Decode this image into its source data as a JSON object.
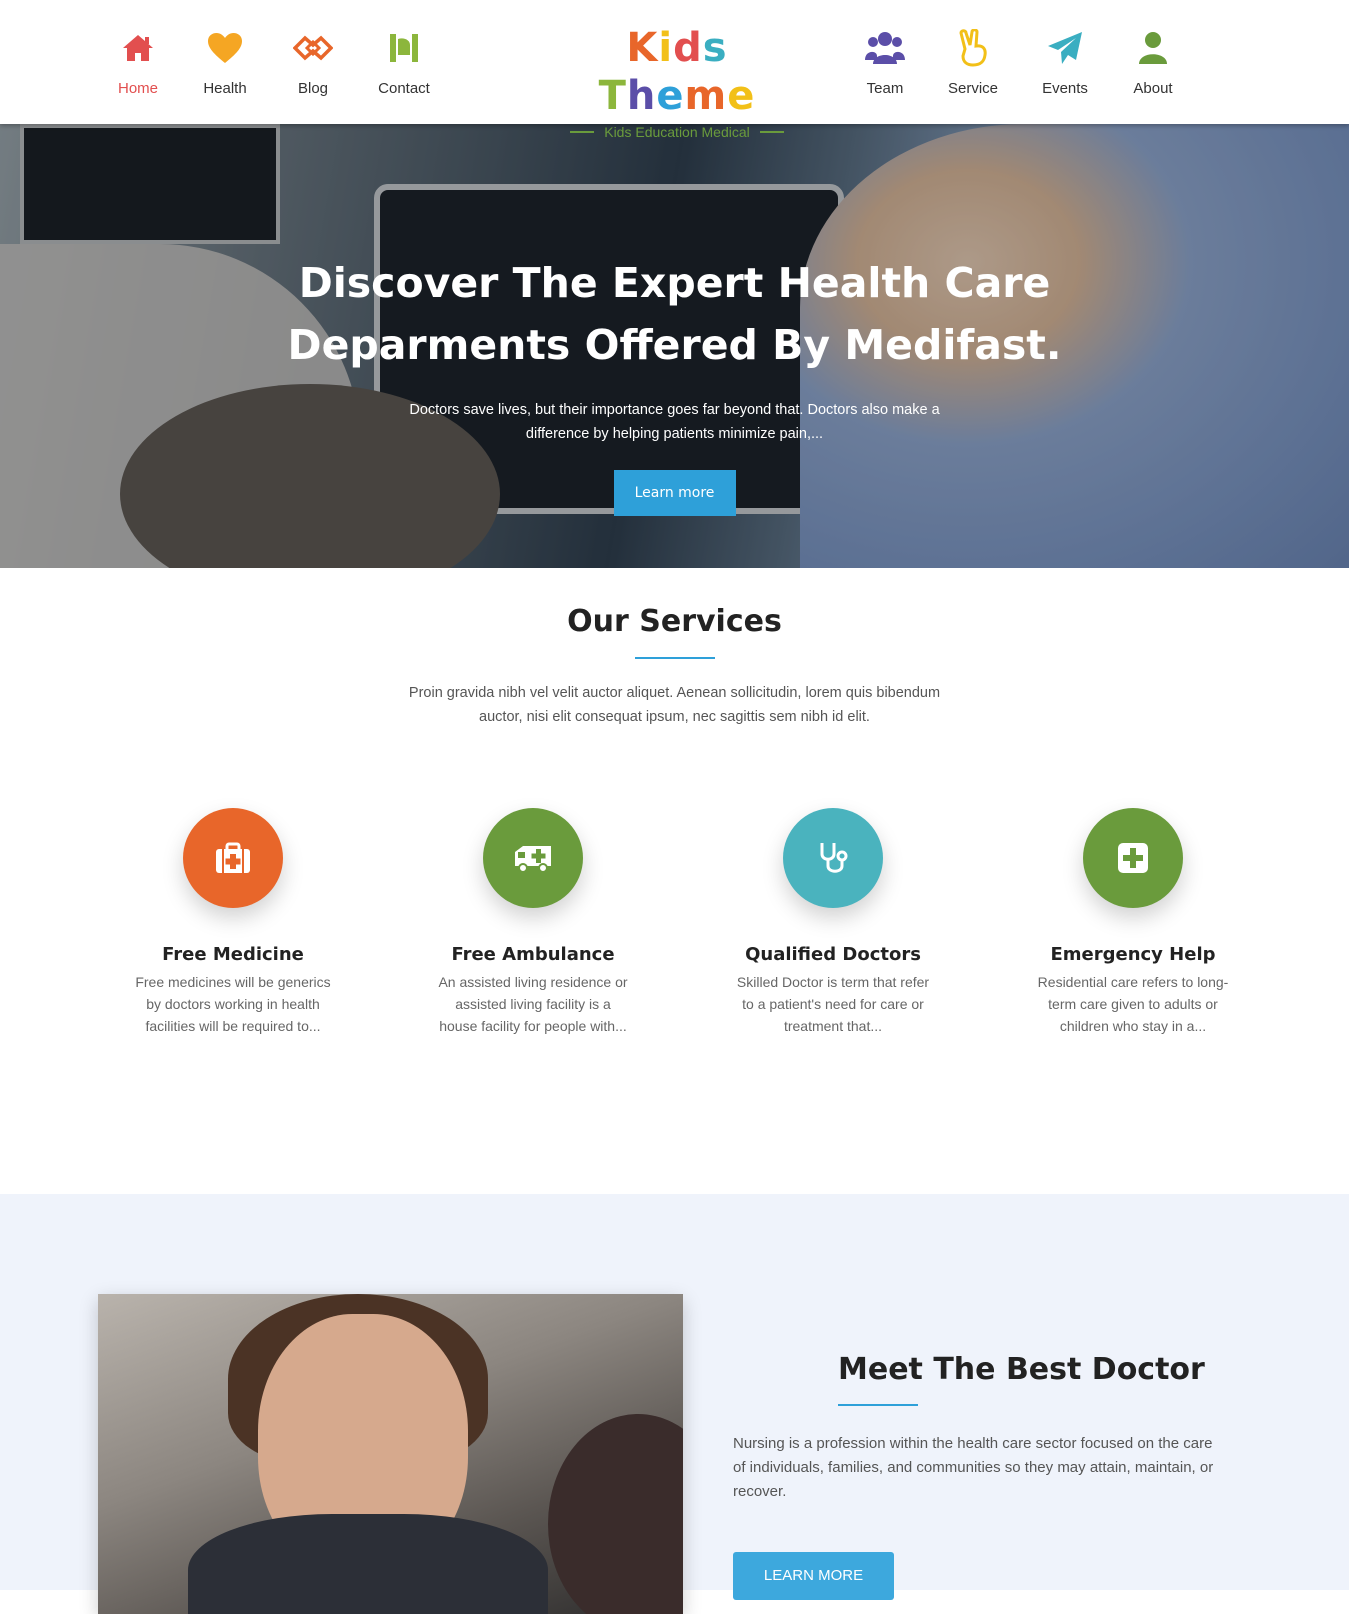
{
  "nav": {
    "left": [
      {
        "label": "Home",
        "icon": "home-icon",
        "color": "#e24f4f",
        "active": true
      },
      {
        "label": "Health",
        "icon": "heart-icon",
        "color": "#f5a623"
      },
      {
        "label": "Blog",
        "icon": "handshake-icon",
        "color": "#e8662a"
      },
      {
        "label": "Contact",
        "icon": "phone-icon",
        "color": "#8cb63c"
      }
    ],
    "right": [
      {
        "label": "Team",
        "icon": "users-icon",
        "color": "#5b4ea8"
      },
      {
        "label": "Service",
        "icon": "hand-peace-icon",
        "color": "#f2c018"
      },
      {
        "label": "Events",
        "icon": "paper-plane-icon",
        "color": "#3aaec1"
      },
      {
        "label": "About",
        "icon": "user-icon",
        "color": "#6a9b3c"
      }
    ]
  },
  "logo": {
    "title": "Kids Theme",
    "subtitle": "Kids Education Medical",
    "letter_colors": [
      "#e8662a",
      "#f2c018",
      "#e24f4f",
      "#3aaec1",
      "#ffffff",
      "#8cb63c",
      "#5b4ea8",
      "#2ea0d9",
      "#e8662a",
      "#f2c018"
    ]
  },
  "hero": {
    "title_line1": "Discover The Expert Health Care",
    "title_line2": "Deparments Offered By Medifast.",
    "text": "Doctors save lives, but their importance goes far beyond that. Doctors also make a difference by helping patients minimize pain,...",
    "button": "Learn more"
  },
  "services": {
    "title": "Our Services",
    "text": "Proin gravida nibh vel velit auctor aliquet. Aenean sollicitudin, lorem quis bibendum auctor, nisi elit consequat ipsum, nec sagittis sem nibh id elit.",
    "items": [
      {
        "title": "Free Medicine",
        "text": "Free medicines will be generics by doctors working in health facilities will be required to...",
        "icon": "medkit-icon",
        "color": "#e8662a"
      },
      {
        "title": "Free Ambulance",
        "text": "An assisted living residence or assisted living facility is a house facility for people with...",
        "icon": "ambulance-icon",
        "color": "#6a9b3c"
      },
      {
        "title": "Qualified Doctors",
        "text": "Skilled Doctor is term that refer to a patient's need for care or treatment that...",
        "icon": "stethoscope-icon",
        "color": "#4ab3be"
      },
      {
        "title": "Emergency Help",
        "text": "Residential care refers to long-term care given to adults or children who stay in a...",
        "icon": "plus-square-icon",
        "color": "#6a9b3c"
      }
    ]
  },
  "doctor": {
    "title": "Meet The Best Doctor",
    "text": "Nursing is a profession within the health care sector focused on the care of individuals, families, and communities so they may attain, maintain, or recover.",
    "button": "LEARN MORE"
  }
}
